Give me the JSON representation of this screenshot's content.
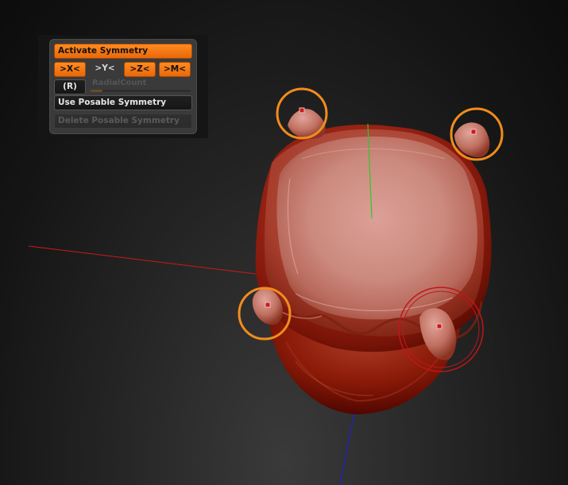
{
  "symmetry_panel": {
    "activate_label": "Activate Symmetry",
    "axis_x_label": ">X<",
    "axis_y_label": ">Y<",
    "axis_z_label": ">Z<",
    "axis_m_label": ">M<",
    "radial_button_label": "(R)",
    "radial_count_label": "RadialCount",
    "radial_count_level": 0.12,
    "use_posable_label": "Use Posable Symmetry",
    "delete_posable_label": "Delete Posable Symmetry"
  },
  "colors": {
    "accent_orange": "#f28c1c",
    "active_brush_red": "#c0161a",
    "mesh_base": "#b03a2a",
    "mesh_highlight": "#d9958a",
    "axis_red": "#d01818",
    "axis_green": "#2ec82e",
    "axis_blue": "#2020c8",
    "marker_fill": "#d01818"
  }
}
